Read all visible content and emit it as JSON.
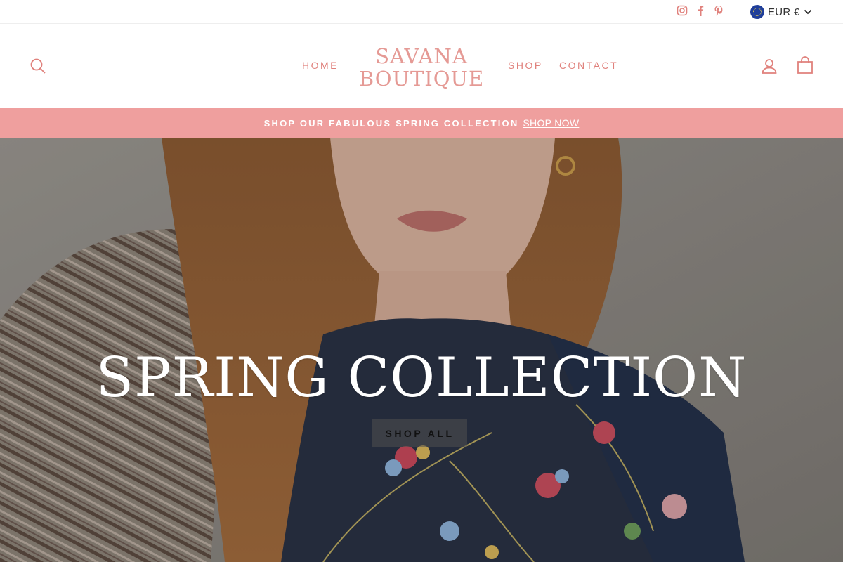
{
  "utility": {
    "social": [
      "instagram-icon",
      "facebook-icon",
      "pinterest-icon"
    ],
    "currency": {
      "label": "EUR €",
      "flag": "eu-flag-icon"
    }
  },
  "header": {
    "logo_line1": "SAVANA",
    "logo_line2": "BOUTIQUE",
    "nav": {
      "home": "HOME",
      "shop": "SHOP",
      "contact": "CONTACT"
    },
    "icons": {
      "search": "search-icon",
      "account": "user-icon",
      "cart": "bag-icon"
    },
    "accent_color": "#e0817c"
  },
  "promo": {
    "text": "SHOP OUR FABULOUS SPRING COLLECTION",
    "link": "SHOP NOW",
    "background": "#ef9f9e"
  },
  "hero": {
    "title": "SPRING COLLECTION",
    "button": "SHOP ALL"
  }
}
